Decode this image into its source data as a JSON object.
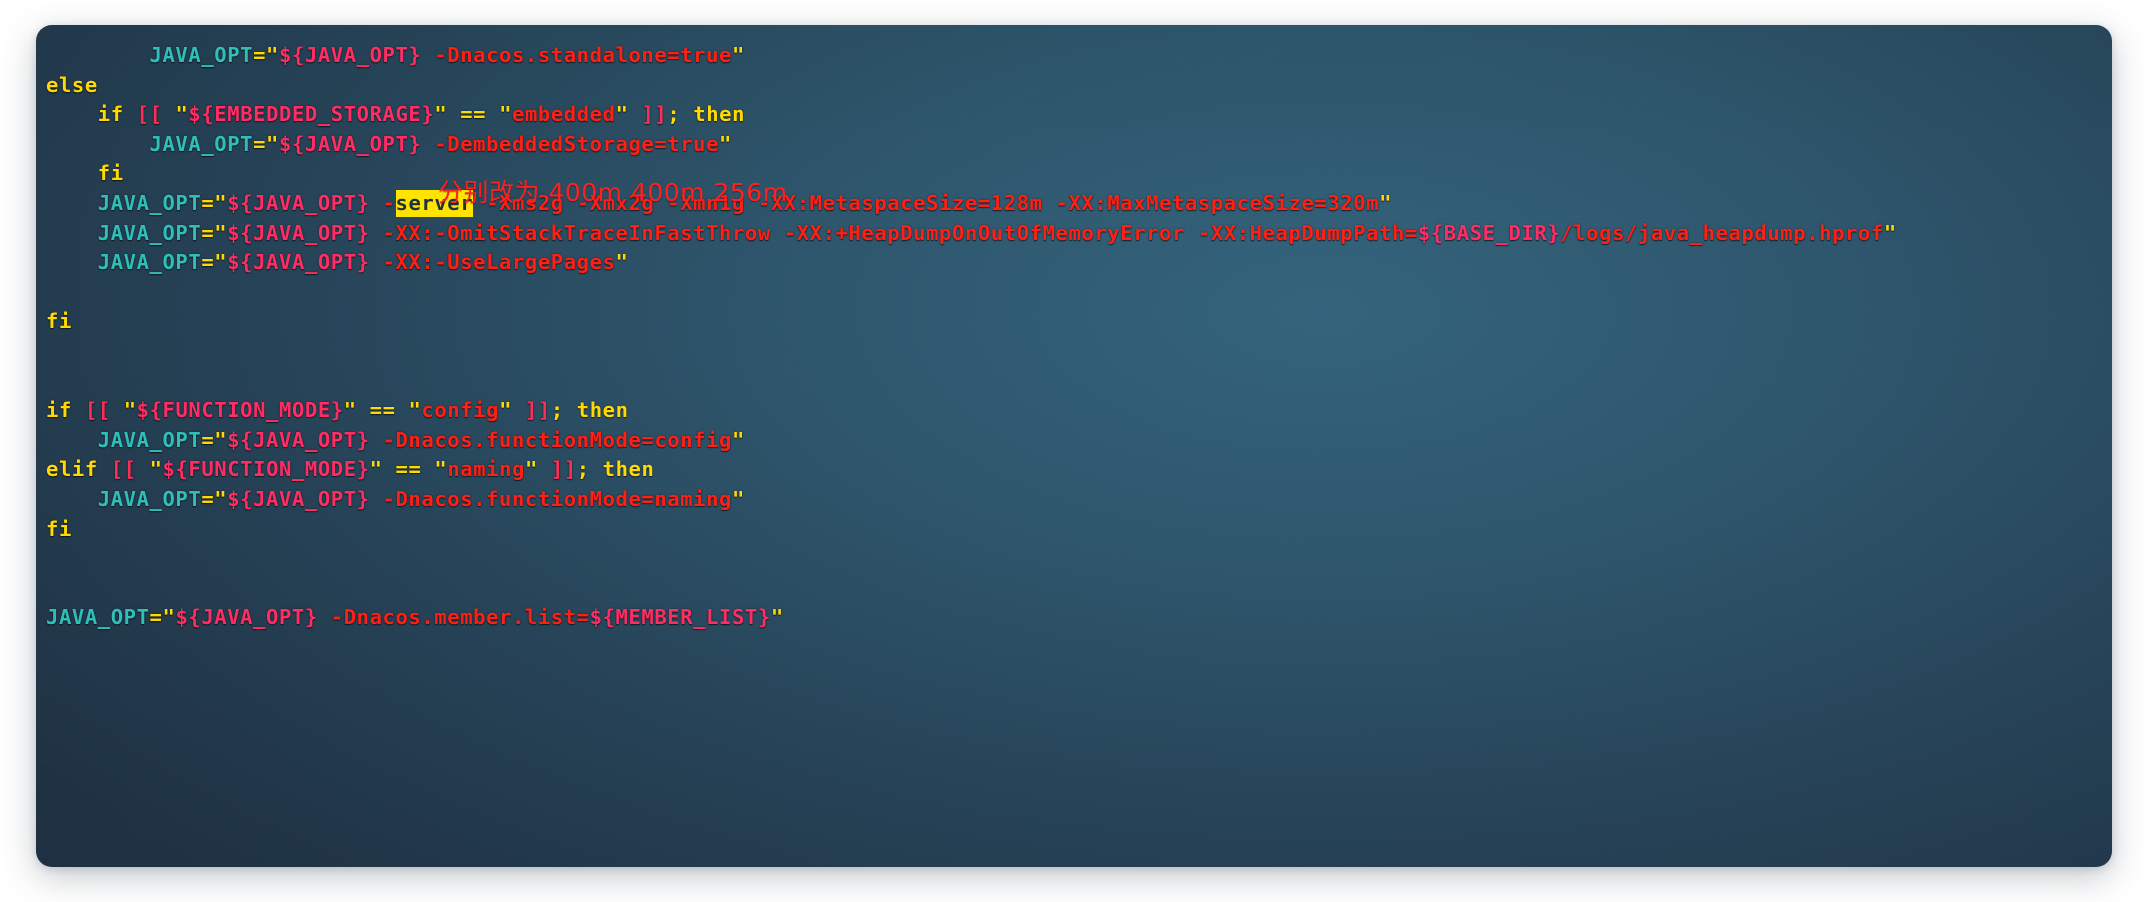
{
  "window": {
    "kind": "code-screenshot",
    "panel_background_center": "#2a4e63",
    "panel_background_edge": "#1d2c3e",
    "page_background": "#ffffff"
  },
  "palette": {
    "variable_teal": "#2fbfb8",
    "keyword_yellow": "#ffd900",
    "bracket_pink_red": "#ff2d55",
    "string_red": "#ff1f15",
    "expansion_pink": "#ff2d64",
    "highlight_background": "#ffe400",
    "highlight_text": "#20323f",
    "annotation_red": "#ff2020"
  },
  "annotation": {
    "text": "分别改为 400m 400m 256m",
    "color": "#ff2020"
  },
  "code": {
    "language": "shell",
    "lines": [
      {
        "id": "line-1-standalone-opt",
        "indent": 2,
        "text": "JAVA_OPT=\"${JAVA_OPT} -Dnacos.standalone=true\"",
        "tokens": [
          {
            "t": "JAVA_OPT",
            "c": "t-var"
          },
          {
            "t": "=",
            "c": "t-kw"
          },
          {
            "t": "\"",
            "c": "t-kw"
          },
          {
            "t": "${JAVA_OPT}",
            "c": "t-expand"
          },
          {
            "t": " -Dnacos.standalone=true",
            "c": "t-str"
          },
          {
            "t": "\"",
            "c": "t-kw"
          }
        ]
      },
      {
        "id": "line-2-else",
        "indent": 0,
        "text": "else",
        "tokens": [
          {
            "t": "else",
            "c": "t-kw"
          }
        ]
      },
      {
        "id": "line-3-if-embedded-storage",
        "indent": 1,
        "text": "if [[ \"${EMBEDDED_STORAGE}\" == \"embedded\" ]]; then",
        "tokens": [
          {
            "t": "if",
            "c": "t-kw"
          },
          {
            "t": " ",
            "c": "t-plain"
          },
          {
            "t": "[[",
            "c": "t-brk"
          },
          {
            "t": " ",
            "c": "t-plain"
          },
          {
            "t": "\"",
            "c": "t-kw"
          },
          {
            "t": "${EMBEDDED_STORAGE}",
            "c": "t-expand"
          },
          {
            "t": "\"",
            "c": "t-kw"
          },
          {
            "t": " ",
            "c": "t-plain"
          },
          {
            "t": "==",
            "c": "t-kw"
          },
          {
            "t": " ",
            "c": "t-plain"
          },
          {
            "t": "\"",
            "c": "t-kw"
          },
          {
            "t": "embedded",
            "c": "t-str"
          },
          {
            "t": "\"",
            "c": "t-kw"
          },
          {
            "t": " ",
            "c": "t-plain"
          },
          {
            "t": "]]",
            "c": "t-brk"
          },
          {
            "t": ";",
            "c": "t-kw"
          },
          {
            "t": " ",
            "c": "t-plain"
          },
          {
            "t": "then",
            "c": "t-kw"
          }
        ]
      },
      {
        "id": "line-4-embedded-storage-opt",
        "indent": 2,
        "text": "JAVA_OPT=\"${JAVA_OPT} -DembeddedStorage=true\"",
        "tokens": [
          {
            "t": "JAVA_OPT",
            "c": "t-var"
          },
          {
            "t": "=",
            "c": "t-kw"
          },
          {
            "t": "\"",
            "c": "t-kw"
          },
          {
            "t": "${JAVA_OPT}",
            "c": "t-expand"
          },
          {
            "t": " -DembeddedStorage=true",
            "c": "t-str"
          },
          {
            "t": "\"",
            "c": "t-kw"
          }
        ]
      },
      {
        "id": "line-5-fi-inner",
        "indent": 1,
        "text": "fi",
        "tokens": [
          {
            "t": "fi",
            "c": "t-kw"
          }
        ]
      },
      {
        "id": "line-6-memory-opts",
        "indent": 1,
        "text": "JAVA_OPT=\"${JAVA_OPT} -server -Xms2g -Xmx2g -Xmn1g -XX:MetaspaceSize=128m -XX:MaxMetaspaceSize=320m\"",
        "tokens": [
          {
            "t": "JAVA_OPT",
            "c": "t-var"
          },
          {
            "t": "=",
            "c": "t-kw"
          },
          {
            "t": "\"",
            "c": "t-kw"
          },
          {
            "t": "${JAVA_OPT}",
            "c": "t-expand"
          },
          {
            "t": " -",
            "c": "t-str"
          },
          {
            "t": "server",
            "c": "hl"
          },
          {
            "t": " -Xms2g -Xmx2g -Xmn1g -XX:MetaspaceSize=128m -XX:MaxMetaspaceSize=320m",
            "c": "t-str"
          },
          {
            "t": "\"",
            "c": "t-kw"
          }
        ]
      },
      {
        "id": "line-7-heapdump-opts",
        "indent": 1,
        "text": "JAVA_OPT=\"${JAVA_OPT} -XX:-OmitStackTraceInFastThrow -XX:+HeapDumpOnOutOfMemoryError -XX:HeapDumpPath=${BASE_DIR}/logs/java_heapdump.hprof\"",
        "tokens": [
          {
            "t": "JAVA_OPT",
            "c": "t-var"
          },
          {
            "t": "=",
            "c": "t-kw"
          },
          {
            "t": "\"",
            "c": "t-kw"
          },
          {
            "t": "${JAVA_OPT}",
            "c": "t-expand"
          },
          {
            "t": " -XX:-OmitStackTraceInFastThrow -XX:+HeapDumpOnOutOfMemoryError -XX:HeapDumpPath=",
            "c": "t-str"
          },
          {
            "t": "${BASE_DIR}",
            "c": "t-expand"
          },
          {
            "t": "/logs/java_heapdump.hprof",
            "c": "t-str"
          },
          {
            "t": "\"",
            "c": "t-kw"
          }
        ]
      },
      {
        "id": "line-8-uselargepages-opt",
        "indent": 1,
        "text": "JAVA_OPT=\"${JAVA_OPT} -XX:-UseLargePages\"",
        "tokens": [
          {
            "t": "JAVA_OPT",
            "c": "t-var"
          },
          {
            "t": "=",
            "c": "t-kw"
          },
          {
            "t": "\"",
            "c": "t-kw"
          },
          {
            "t": "${JAVA_OPT}",
            "c": "t-expand"
          },
          {
            "t": " -XX:-UseLargePages",
            "c": "t-str"
          },
          {
            "t": "\"",
            "c": "t-kw"
          }
        ]
      },
      {
        "id": "line-9-blank",
        "indent": 0,
        "text": "",
        "tokens": []
      },
      {
        "id": "line-10-fi-outer",
        "indent": 0,
        "text": "fi",
        "tokens": [
          {
            "t": "fi",
            "c": "t-kw"
          }
        ]
      },
      {
        "id": "line-11-blank",
        "indent": 0,
        "text": "",
        "tokens": []
      },
      {
        "id": "line-12-blank",
        "indent": 0,
        "text": "",
        "tokens": []
      },
      {
        "id": "line-13-if-function-mode-config",
        "indent": 0,
        "text": "if [[ \"${FUNCTION_MODE}\" == \"config\" ]]; then",
        "tokens": [
          {
            "t": "if",
            "c": "t-kw"
          },
          {
            "t": " ",
            "c": "t-plain"
          },
          {
            "t": "[[",
            "c": "t-brk"
          },
          {
            "t": " ",
            "c": "t-plain"
          },
          {
            "t": "\"",
            "c": "t-kw"
          },
          {
            "t": "${FUNCTION_MODE}",
            "c": "t-expand"
          },
          {
            "t": "\"",
            "c": "t-kw"
          },
          {
            "t": " ",
            "c": "t-plain"
          },
          {
            "t": "==",
            "c": "t-kw"
          },
          {
            "t": " ",
            "c": "t-plain"
          },
          {
            "t": "\"",
            "c": "t-kw"
          },
          {
            "t": "config",
            "c": "t-str"
          },
          {
            "t": "\"",
            "c": "t-kw"
          },
          {
            "t": " ",
            "c": "t-plain"
          },
          {
            "t": "]]",
            "c": "t-brk"
          },
          {
            "t": ";",
            "c": "t-kw"
          },
          {
            "t": " ",
            "c": "t-plain"
          },
          {
            "t": "then",
            "c": "t-kw"
          }
        ]
      },
      {
        "id": "line-14-function-mode-config-opt",
        "indent": 1,
        "text": "JAVA_OPT=\"${JAVA_OPT} -Dnacos.functionMode=config\"",
        "tokens": [
          {
            "t": "JAVA_OPT",
            "c": "t-var"
          },
          {
            "t": "=",
            "c": "t-kw"
          },
          {
            "t": "\"",
            "c": "t-kw"
          },
          {
            "t": "${JAVA_OPT}",
            "c": "t-expand"
          },
          {
            "t": " -Dnacos.functionMode=config",
            "c": "t-str"
          },
          {
            "t": "\"",
            "c": "t-kw"
          }
        ]
      },
      {
        "id": "line-15-elif-function-mode-naming",
        "indent": 0,
        "text": "elif [[ \"${FUNCTION_MODE}\" == \"naming\" ]]; then",
        "tokens": [
          {
            "t": "elif",
            "c": "t-kw"
          },
          {
            "t": " ",
            "c": "t-plain"
          },
          {
            "t": "[[",
            "c": "t-brk"
          },
          {
            "t": " ",
            "c": "t-plain"
          },
          {
            "t": "\"",
            "c": "t-kw"
          },
          {
            "t": "${FUNCTION_MODE}",
            "c": "t-expand"
          },
          {
            "t": "\"",
            "c": "t-kw"
          },
          {
            "t": " ",
            "c": "t-plain"
          },
          {
            "t": "==",
            "c": "t-kw"
          },
          {
            "t": " ",
            "c": "t-plain"
          },
          {
            "t": "\"",
            "c": "t-kw"
          },
          {
            "t": "naming",
            "c": "t-str"
          },
          {
            "t": "\"",
            "c": "t-kw"
          },
          {
            "t": " ",
            "c": "t-plain"
          },
          {
            "t": "]]",
            "c": "t-brk"
          },
          {
            "t": ";",
            "c": "t-kw"
          },
          {
            "t": " ",
            "c": "t-plain"
          },
          {
            "t": "then",
            "c": "t-kw"
          }
        ]
      },
      {
        "id": "line-16-function-mode-naming-opt",
        "indent": 1,
        "text": "JAVA_OPT=\"${JAVA_OPT} -Dnacos.functionMode=naming\"",
        "tokens": [
          {
            "t": "JAVA_OPT",
            "c": "t-var"
          },
          {
            "t": "=",
            "c": "t-kw"
          },
          {
            "t": "\"",
            "c": "t-kw"
          },
          {
            "t": "${JAVA_OPT}",
            "c": "t-expand"
          },
          {
            "t": " -Dnacos.functionMode=naming",
            "c": "t-str"
          },
          {
            "t": "\"",
            "c": "t-kw"
          }
        ]
      },
      {
        "id": "line-17-fi-function-mode",
        "indent": 0,
        "text": "fi",
        "tokens": [
          {
            "t": "fi",
            "c": "t-kw"
          }
        ]
      },
      {
        "id": "line-18-blank",
        "indent": 0,
        "text": "",
        "tokens": []
      },
      {
        "id": "line-19-blank",
        "indent": 0,
        "text": "",
        "tokens": []
      },
      {
        "id": "line-20-member-list-opt",
        "indent": 0,
        "text": "JAVA_OPT=\"${JAVA_OPT} -Dnacos.member.list=${MEMBER_LIST}\"",
        "tokens": [
          {
            "t": "JAVA_OPT",
            "c": "t-var"
          },
          {
            "t": "=",
            "c": "t-kw"
          },
          {
            "t": "\"",
            "c": "t-kw"
          },
          {
            "t": "${JAVA_OPT}",
            "c": "t-expand"
          },
          {
            "t": " -Dnacos.member.list=",
            "c": "t-str"
          },
          {
            "t": "${MEMBER_LIST}",
            "c": "t-expand"
          },
          {
            "t": "\"",
            "c": "t-kw"
          }
        ]
      }
    ]
  }
}
